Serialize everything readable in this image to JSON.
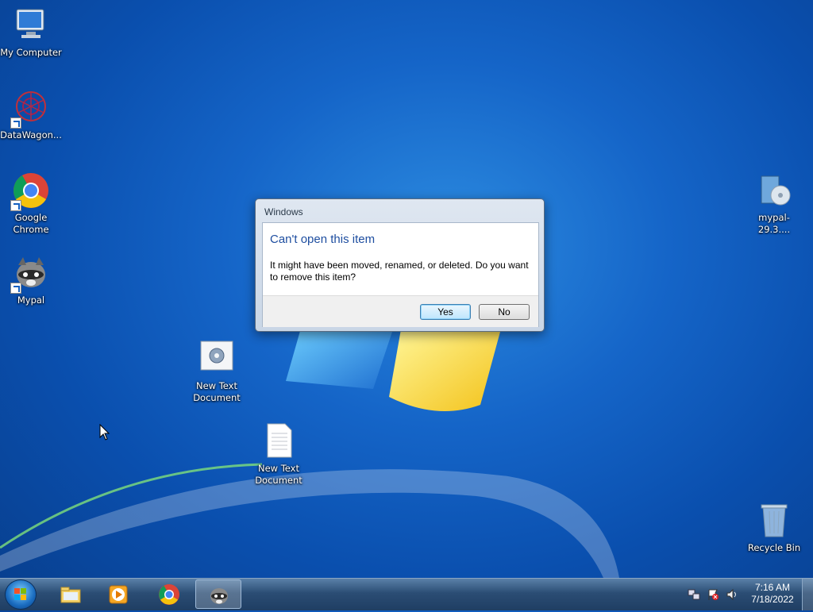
{
  "desktop": {
    "icons": [
      {
        "label": "My Computer"
      },
      {
        "label": "DataWagon..."
      },
      {
        "label": "Google Chrome"
      },
      {
        "label": "Mypal"
      },
      {
        "label": "New Text Document"
      },
      {
        "label": "New Text Document"
      },
      {
        "label": "mypal-29.3...."
      },
      {
        "label": "Recycle Bin"
      }
    ]
  },
  "dialog": {
    "title": "Windows",
    "heading": "Can't open this item",
    "message": "It might have been moved, renamed, or deleted. Do you want to remove this item?",
    "yes_label": "Yes",
    "no_label": "No"
  },
  "taskbar": {
    "pinned": [
      {
        "icon": "file-explorer-icon"
      },
      {
        "icon": "media-player-icon"
      },
      {
        "icon": "chrome-icon"
      },
      {
        "icon": "mypal-icon",
        "active": true
      }
    ],
    "clock": {
      "time": "7:16 AM",
      "date": "7/18/2022"
    }
  },
  "colors": {
    "dialog_heading": "#1e4ea0",
    "desktop_blue": "#1565c8"
  }
}
